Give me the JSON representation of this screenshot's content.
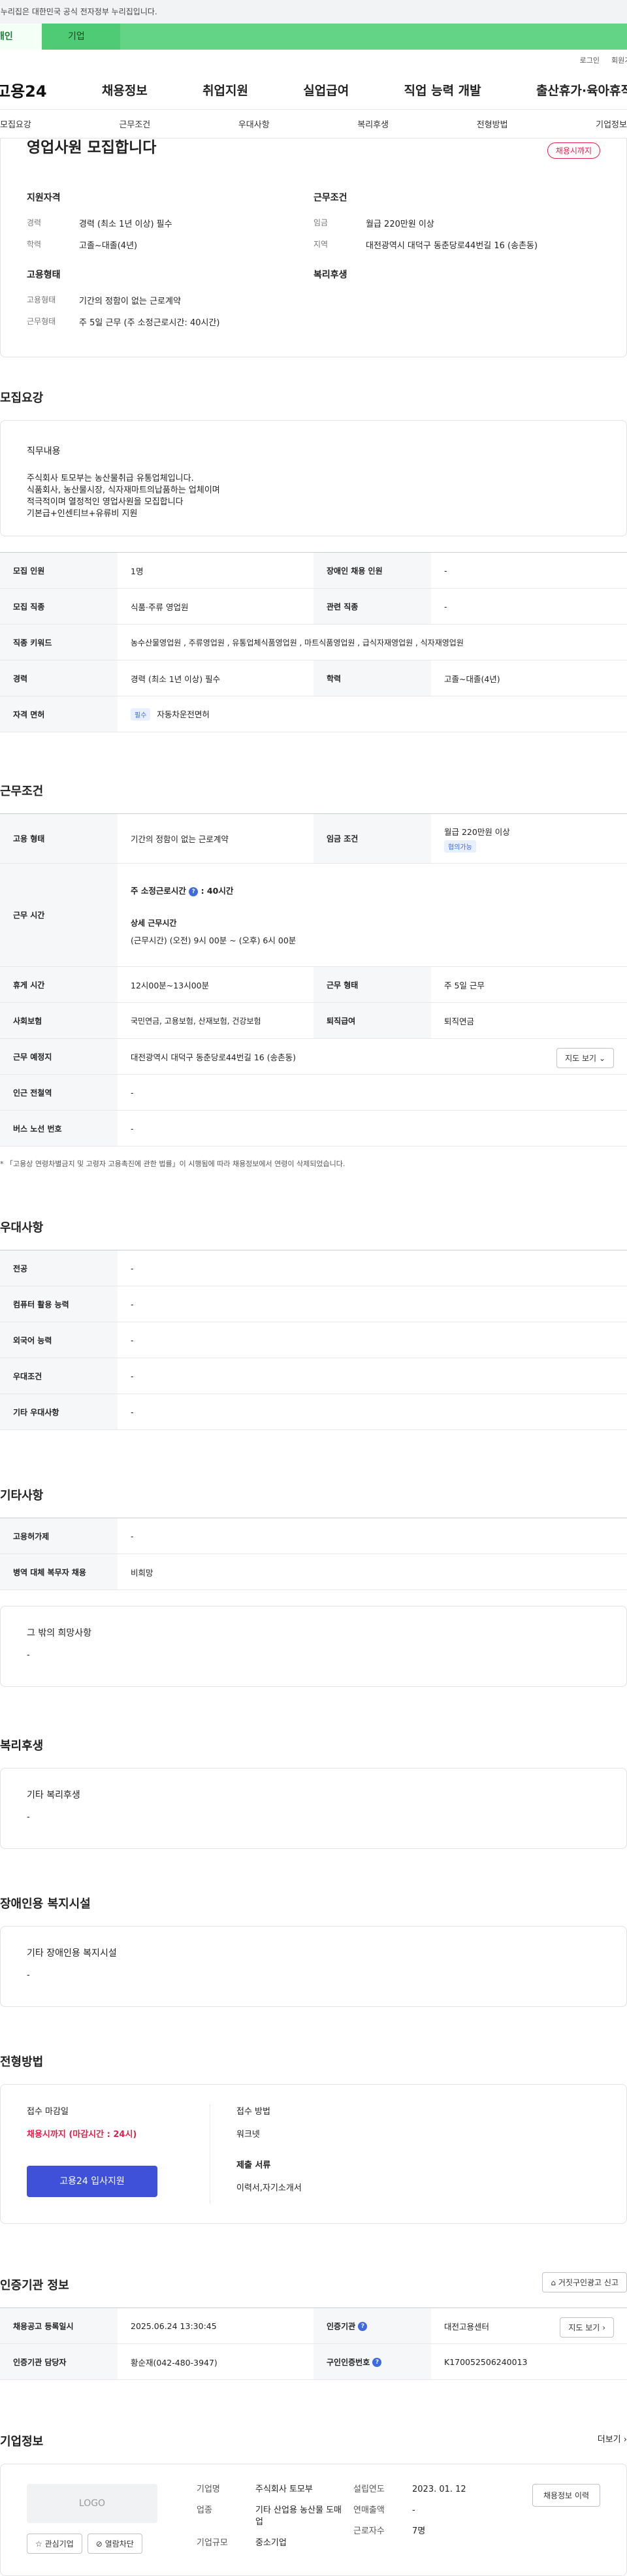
{
  "gov_banner": "이 누리집은 대한민국 공식 전자정부 누리집입니다.",
  "user_tabs": {
    "personal": "개인",
    "corporate": "기업"
  },
  "util_links": [
    "로그인",
    "회원가입"
  ],
  "gnb": {
    "logo": "고용24",
    "items": [
      "채용정보",
      "취업지원",
      "실업급여",
      "직업 능력 개발",
      "출산휴가·육아휴직"
    ]
  },
  "subnav": [
    "모집요강",
    "근무조건",
    "우대사항",
    "복리후생",
    "전형방법",
    "기업정보"
  ],
  "summary": {
    "title": "영업사원 모집합니다",
    "dday": "채용시까지",
    "qual": {
      "title": "지원자격",
      "rows": [
        {
          "k": "경력",
          "v": "경력 (최소 1년 이상) 필수"
        },
        {
          "k": "학력",
          "v": "고졸~대졸(4년)"
        }
      ]
    },
    "cond": {
      "title": "근무조건",
      "rows": [
        {
          "k": "임금",
          "v": "월급 220만원 이상"
        },
        {
          "k": "지역",
          "v": "대전광역시 대덕구 동춘당로44번길 16 (송촌동)"
        }
      ]
    },
    "emp": {
      "title": "고용형태",
      "rows": [
        {
          "k": "고용형태",
          "v": "기간의 정함이 없는 근로계약"
        },
        {
          "k": "근무형태",
          "v": "주 5일 근무 (주 소정근로시간: 40시간)"
        }
      ]
    },
    "welfare": {
      "title": "복리후생"
    }
  },
  "recruit": {
    "title": "모집요강",
    "duty_title": "직무내용",
    "duty_lines": [
      "주식회사 토모부는 농산물취급 유통업체입니다.",
      "식품회사, 농산물시장, 식자재마트의납품하는 업체이며",
      "적극적이며 열정적인 영업사원을 모집합니다",
      "기본급+인센티브+유류비 지원"
    ],
    "rows": [
      {
        "k1": "모집 인원",
        "v1": "1명",
        "k2": "장애인 채용 인원",
        "v2": "-"
      },
      {
        "k1": "모집 직종",
        "v1": "식품·주류 영업원",
        "k2": "관련 직종",
        "v2": "-"
      },
      {
        "k1": "직종 키워드",
        "v1": "농수산물영업원 , 주류영업원 , 유통업체식품영업원 , 마트식품영업원 , 급식자재영업원 , 식자재영업원"
      },
      {
        "k1": "경력",
        "v1": "경력 (최소 1년 이상) 필수",
        "k2": "학력",
        "v2": "고졸~대졸(4년)"
      },
      {
        "k1": "자격 면허",
        "badge": "필수",
        "v1": "자동차운전면허"
      }
    ]
  },
  "work": {
    "title": "근무조건",
    "emp_type_k": "고용 형태",
    "emp_type_v": "기간의 정함이 없는 근로계약",
    "wage_k": "임금 조건",
    "wage_v": "월급 220만원 이상",
    "wage_badge": "협의가능",
    "hours_k": "근무 시간",
    "hours_main": "주 소정근로시간",
    "hours_val": "40시간",
    "hours_detail_title": "상세 근무시간",
    "hours_detail": "(근무시간) (오전) 9시 00분 ~ (오후) 6시 00분",
    "rows": [
      {
        "k1": "휴게 시간",
        "v1": "12시00분~13시00분",
        "k2": "근무 형태",
        "v2": "주 5일 근무"
      },
      {
        "k1": "사회보험",
        "v1": "국민연금, 고용보험, 산재보험, 건강보험",
        "k2": "퇴직급여",
        "v2": "퇴직연금"
      }
    ],
    "place_k": "근무 예정지",
    "place_v": "대전광역시 대덕구 동춘당로44번길 16 (송촌동)",
    "map_btn": "지도 보기",
    "subway_k": "인근 전철역",
    "subway_v": "-",
    "bus_k": "버스 노선 번호",
    "bus_v": "-",
    "note": "* 「고용상 연령차별금지 및 고령자 고용촉진에 관한 법률」이 시행됨에 따라 채용정보에서 연령이 삭제되었습니다."
  },
  "pref": {
    "title": "우대사항",
    "rows": [
      {
        "k": "전공",
        "v": "-"
      },
      {
        "k": "컴퓨터 활용 능력",
        "v": "-"
      },
      {
        "k": "외국어 능력",
        "v": "-"
      },
      {
        "k": "우대조건",
        "v": "-"
      },
      {
        "k": "기타 우대사항",
        "v": "-"
      }
    ]
  },
  "etc": {
    "title": "기타사항",
    "rows": [
      {
        "k": "고용허가제",
        "v": "-"
      },
      {
        "k": "병역 대체 복무자 채용",
        "v": "비희망"
      }
    ],
    "wish_title": "그 밖의 희망사항",
    "wish_value": "-"
  },
  "welfare": {
    "title": "복리후생",
    "box_title": "기타 복리후생",
    "box_value": "-"
  },
  "disability": {
    "title": "장애인용 복지시설",
    "box_title": "기타 장애인용 복지시설",
    "box_value": "-"
  },
  "selection": {
    "title": "전형방법",
    "deadline_label": "접수 마감일",
    "deadline_value": "채용시까지 (마감시간 : 24시)",
    "apply_btn": "고용24 입사지원",
    "method_label": "접수 방법",
    "method_value": "워크넷",
    "docs_label": "제출 서류",
    "docs_value": "이력서,자기소개서"
  },
  "cert": {
    "title": "인증기관 정보",
    "report_btn": "거짓구인광고 신고",
    "r1": {
      "k1": "채용공고 등록일시",
      "v1": "2025.06.24 13:30:45",
      "k2": "인증기관",
      "v2": "대전고용센터",
      "btn": "지도 보기"
    },
    "r2": {
      "k1": "인증기관 담당자",
      "v1": "황순재(042-480-3947)",
      "k2": "구인인증번호",
      "v2": "K170052506240013"
    }
  },
  "company": {
    "title": "기업정보",
    "more": "더보기",
    "logo": "LOGO",
    "fav_btn": "관심기업",
    "block_btn": "열람차단",
    "name_k": "기업명",
    "name_v": "주식회사 토모부",
    "industry_k": "업종",
    "industry_v": "기타 산업용 농산물 도매업",
    "size_k": "기업규모",
    "size_v": "중소기업",
    "founded_k": "설립연도",
    "founded_v": "2023. 01. 12",
    "sales_k": "연매출액",
    "sales_v": "-",
    "emp_k": "근로자수",
    "emp_v": "7명",
    "history_btn": "채용정보 이력"
  }
}
